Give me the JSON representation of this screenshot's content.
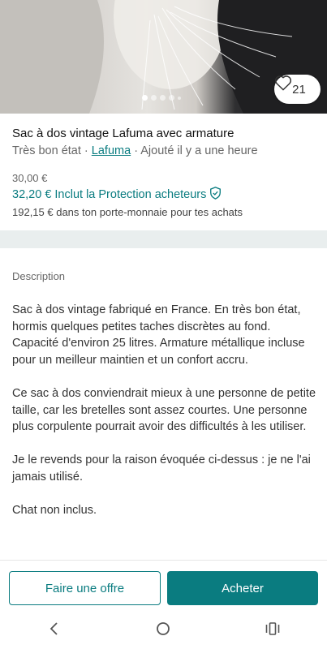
{
  "listing": {
    "favorites_count": "21",
    "carousel": {
      "total": 5,
      "active_index": 0
    },
    "title": "Sac à dos vintage Lafuma avec armature",
    "condition": "Très bon état",
    "separator": " · ",
    "brand": "Lafuma",
    "added": "Ajouté il y a une heure",
    "price": "30,00 €",
    "price_with_protection": "32,20 €",
    "protection_label": "Inclut la Protection acheteurs",
    "wallet_text": "192,15 € dans ton porte-monnaie pour tes achats"
  },
  "description": {
    "label": "Description",
    "paragraphs": [
      "Sac à dos vintage fabriqué en France. En très bon état, hormis quelques petites taches discrètes au fond. Capacité d'environ 25 litres. Armature métallique incluse pour un meilleur maintien et un confort accru.",
      "Ce sac à dos conviendrait mieux à une personne de petite taille, car les bretelles sont assez courtes. Une personne plus corpulente pourrait avoir des difficultés à les utiliser.",
      "Je le revends pour la raison évoquée ci-dessus : je ne l'ai jamais utilisé.",
      "Chat non inclus."
    ]
  },
  "actions": {
    "offer_label": "Faire une offre",
    "buy_label": "Acheter"
  },
  "colors": {
    "accent": "#0a7c80",
    "band": "#e9eeee"
  },
  "icons": {
    "favorite": "heart-icon",
    "protection": "shield-check-icon",
    "nav_back": "back-icon",
    "nav_home": "home-icon",
    "nav_recents": "recents-icon"
  }
}
